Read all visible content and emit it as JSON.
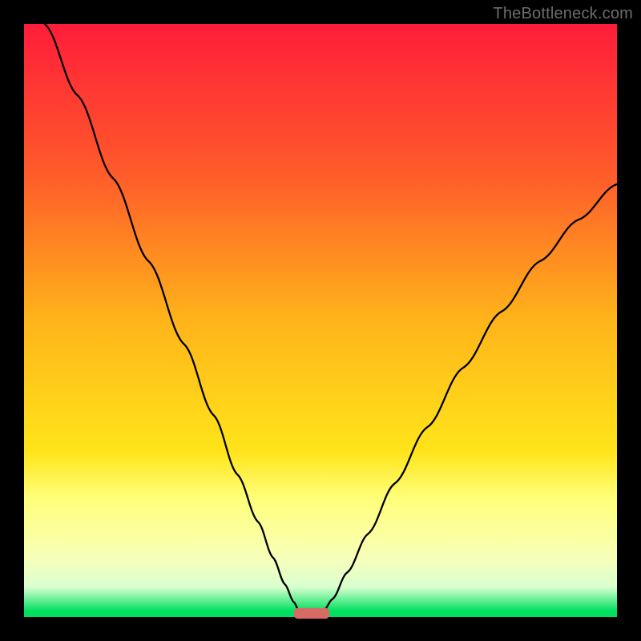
{
  "watermark": "TheBottleneck.com",
  "background_gradient": {
    "direction": "top-to-bottom",
    "stops": [
      {
        "pos": 0.0,
        "color": "#ff1d3a"
      },
      {
        "pos": 0.25,
        "color": "#ff5a2a"
      },
      {
        "pos": 0.5,
        "color": "#ffb41a"
      },
      {
        "pos": 0.72,
        "color": "#ffe41a"
      },
      {
        "pos": 0.8,
        "color": "#ffff7a"
      },
      {
        "pos": 0.9,
        "color": "#f8ffb8"
      },
      {
        "pos": 0.95,
        "color": "#d8ffd0"
      },
      {
        "pos": 0.99,
        "color": "#00e060"
      },
      {
        "pos": 1.0,
        "color": "#00e060"
      }
    ]
  },
  "frame": {
    "outer_size_px": 800,
    "inner_size_px": 740,
    "border_color": "#000000",
    "border_width_px": 30
  },
  "chart_data": {
    "type": "line",
    "title": "",
    "xlabel": "",
    "ylabel": "",
    "xlim": [
      0,
      1
    ],
    "ylim": [
      0,
      1
    ],
    "note": "Two black curves descending from the top edge into a common minimum near the bottom, forming a V/cusp shape. Values are normalized to the plot area (0 = left/bottom, 1 = right/top). Estimated by eye.",
    "series": [
      {
        "name": "left-branch",
        "x": [
          0.035,
          0.09,
          0.15,
          0.21,
          0.27,
          0.32,
          0.36,
          0.395,
          0.42,
          0.44,
          0.455,
          0.464
        ],
        "y": [
          1.0,
          0.88,
          0.74,
          0.6,
          0.46,
          0.34,
          0.24,
          0.16,
          0.1,
          0.055,
          0.025,
          0.01
        ]
      },
      {
        "name": "right-branch",
        "x": [
          0.505,
          0.52,
          0.545,
          0.58,
          0.625,
          0.68,
          0.74,
          0.805,
          0.87,
          0.935,
          1.0
        ],
        "y": [
          0.01,
          0.03,
          0.075,
          0.14,
          0.225,
          0.32,
          0.42,
          0.515,
          0.6,
          0.67,
          0.73
        ]
      }
    ],
    "marker": {
      "name": "min-region",
      "shape": "rounded-rect",
      "x_center": 0.485,
      "y_center": 0.006,
      "width": 0.06,
      "height": 0.018,
      "color": "#d66b66"
    }
  }
}
